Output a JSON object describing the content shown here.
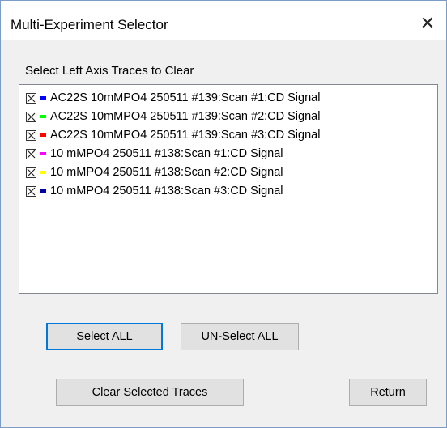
{
  "window": {
    "title": "Multi-Experiment Selector",
    "close_glyph": "✕"
  },
  "group_label": "Select Left Axis Traces to Clear",
  "traces": [
    {
      "label": "AC22S 10mMPO4 250511 #139:Scan #1:CD Signal",
      "checked": true,
      "color": "#0000ff"
    },
    {
      "label": "AC22S 10mMPO4 250511 #139:Scan #2:CD Signal",
      "checked": true,
      "color": "#00ff00"
    },
    {
      "label": "AC22S 10mMPO4 250511 #139:Scan #3:CD Signal",
      "checked": true,
      "color": "#ff0000"
    },
    {
      "label": "10 mMPO4 250511 #138:Scan #1:CD Signal",
      "checked": true,
      "color": "#ff00ff"
    },
    {
      "label": "10 mMPO4 250511 #138:Scan #2:CD Signal",
      "checked": true,
      "color": "#ffff00"
    },
    {
      "label": "10 mMPO4 250511 #138:Scan #3:CD Signal",
      "checked": true,
      "color": "#0000a0"
    }
  ],
  "buttons": {
    "select_all": "Select ALL",
    "unselect_all": "UN-Select ALL",
    "clear_selected": "Clear Selected Traces",
    "return": "Return"
  }
}
